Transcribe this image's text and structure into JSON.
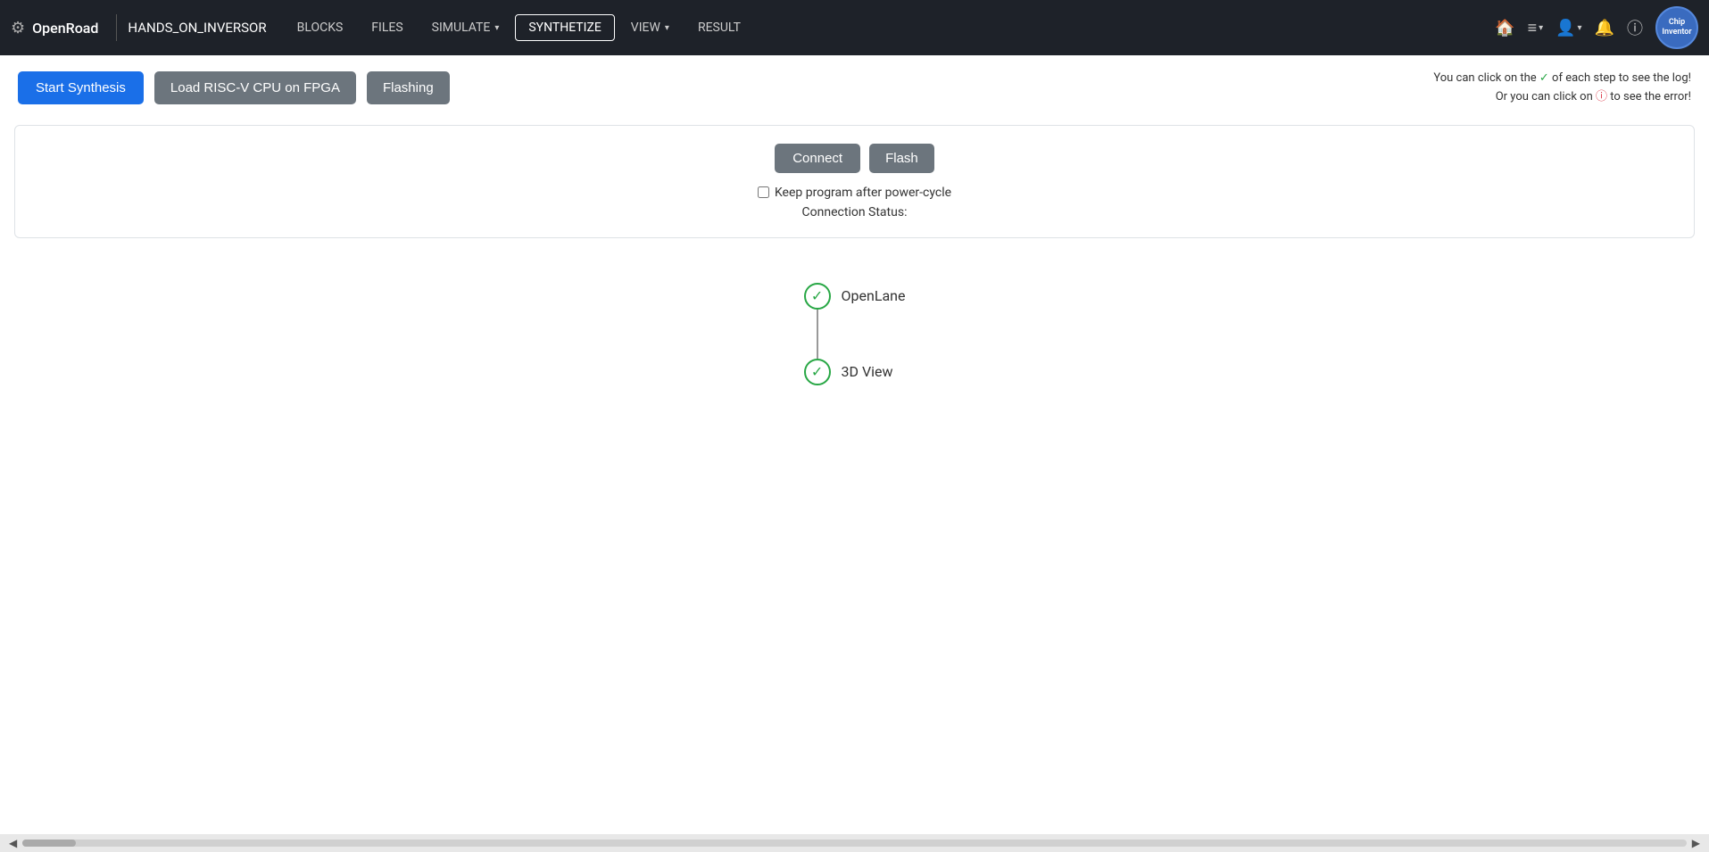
{
  "navbar": {
    "gear_icon": "⚙",
    "brand": "OpenRoad",
    "project": "HANDS_ON_INVERSOR",
    "links": [
      {
        "label": "BLOCKS",
        "active": false,
        "dropdown": false
      },
      {
        "label": "FILES",
        "active": false,
        "dropdown": false
      },
      {
        "label": "SIMULATE",
        "active": false,
        "dropdown": true
      },
      {
        "label": "SYNTHETIZE",
        "active": true,
        "dropdown": false
      },
      {
        "label": "VIEW",
        "active": false,
        "dropdown": true
      },
      {
        "label": "RESULT",
        "active": false,
        "dropdown": false
      }
    ],
    "home_icon": "⌂",
    "menu_icon": "≡",
    "user_icon": "👤",
    "bell_icon": "🔔",
    "info_icon": "ⓘ",
    "logo_line1": "Chip",
    "logo_line2": "Inventor"
  },
  "toolbar": {
    "start_synthesis_label": "Start Synthesis",
    "load_risc_label": "Load RISC-V CPU on FPGA",
    "flashing_label": "Flashing",
    "hint_line1": "You can click on the ✓ of each step to see the log!",
    "hint_line2": "Or you can click on ⓘ to see the error!"
  },
  "flashing_panel": {
    "connect_label": "Connect",
    "flash_label": "Flash",
    "keep_program_label": "Keep program after power-cycle",
    "connection_status_label": "Connection Status:"
  },
  "pipeline": {
    "steps": [
      {
        "label": "OpenLane",
        "status": "success"
      },
      {
        "label": "3D View",
        "status": "success"
      }
    ]
  },
  "scrollbar": {
    "left_arrow": "◀",
    "right_arrow": "▶"
  }
}
